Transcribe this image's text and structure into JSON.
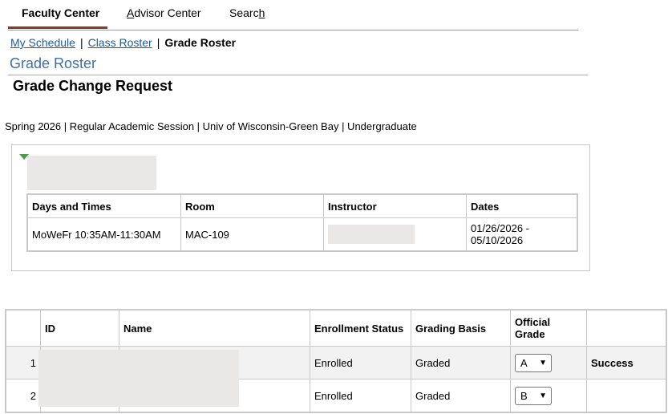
{
  "tabs": [
    {
      "label": "Faculty Center",
      "active": true
    },
    {
      "label_pre": "",
      "label_key": "A",
      "label_post": "dvisor Center"
    },
    {
      "label_pre": "Searc",
      "label_key": "h",
      "label_post": ""
    }
  ],
  "breadcrumb": {
    "link1": "My Schedule",
    "link2": "Class Roster",
    "current": "Grade Roster",
    "separator": "|"
  },
  "page_title": "Grade Roster",
  "sub_title": "Grade Change Request",
  "session_line": "Spring 2026 | Regular Academic Session | Univ of Wisconsin-Green Bay | Undergraduate",
  "meeting": {
    "headers": [
      "Days and Times",
      "Room",
      "Instructor",
      "Dates"
    ],
    "row": {
      "days_times": "MoWeFr 10:35AM-11:30AM",
      "room": "MAC-109",
      "dates": "01/26/2026 - 05/10/2026"
    }
  },
  "roster": {
    "headers": {
      "id": "ID",
      "name": "Name",
      "enroll_status": "Enrollment Status",
      "grading_basis": "Grading Basis",
      "official_grade": "Official Grade"
    },
    "rows": [
      {
        "num": "1",
        "status": "Enrolled",
        "basis": "Graded",
        "grade": "A",
        "result": "Success"
      },
      {
        "num": "2",
        "status": "Enrolled",
        "basis": "Graded",
        "grade": "B",
        "result": ""
      }
    ]
  },
  "icons": {
    "collapse": "triangle-down-icon",
    "select": "chevron-down-icon"
  },
  "colors": {
    "link": "#1a5d9e",
    "title": "#3d6fa8",
    "tab_accent": "#8a3b20",
    "collapse_arrow": "#4f9a4f"
  }
}
